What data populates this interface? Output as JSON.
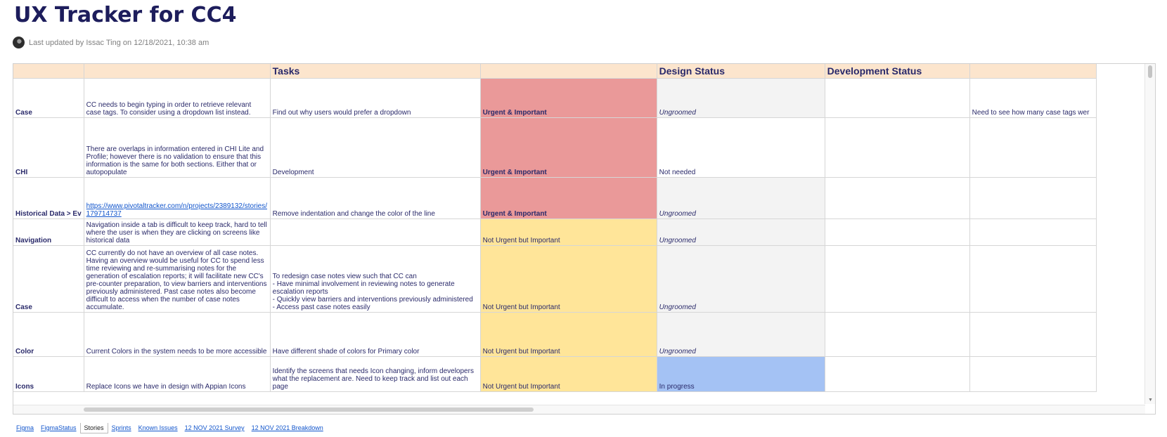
{
  "page": {
    "title": "UX Tracker for CC4",
    "last_updated": "Last updated by Issac Ting on 12/18/2021, 10:38 am"
  },
  "sheet": {
    "headers": [
      "",
      "",
      "Tasks",
      "",
      "Design Status",
      "Development Status",
      ""
    ],
    "rows": [
      {
        "category": "Case",
        "issue": "CC needs to begin typing in order to retrieve relevant case tags. To consider using a dropdown list instead.",
        "task": "Find out why users would prefer a dropdown",
        "priority": "Urgent & Important",
        "design_status": "Ungroomed",
        "dev_status": "",
        "notes": "Need to see how many case tags wer"
      },
      {
        "category": "CHI",
        "issue": "There are overlaps in information entered in CHI Lite and Profile; however there is no validation to ensure that this information is the same for both sections. Either that or autopopulate",
        "task": "Development",
        "priority": "Urgent & Important",
        "design_status": "Not needed",
        "dev_status": "",
        "notes": ""
      },
      {
        "category": "Historical Data > Ev",
        "issue": "https://www.pivotaltracker.com/n/projects/2389132/stories/179714737",
        "task": "Remove indentation and change the color of the line",
        "priority": "Urgent & Important",
        "design_status": "Ungroomed",
        "dev_status": "",
        "notes": ""
      },
      {
        "category": "Navigation",
        "issue": "Navigation inside a tab is difficult to keep track, hard to tell where the user is when they are clicking on screens like historical data",
        "task": "",
        "priority": "Not Urgent but Important",
        "design_status": "Ungroomed",
        "dev_status": "",
        "notes": ""
      },
      {
        "category": "Case",
        "issue": "CC currently do not have an overview of all case notes. Having an overview would be useful for CC to spend less time reviewing and re-summarising notes for the generation of escalation reports; it will facilitate new CC's pre-counter preparation, to view barriers and interventions previously administered. Past case notes also become difficult to access when the number of case notes accumulate.",
        "task": "To redesign case notes view such that CC can\n- Have minimal involvement in reviewing notes to generate escalation reports\n- Quickly view barriers and interventions previously administered\n- Access past case notes easily",
        "priority": "Not Urgent but Important",
        "design_status": "Ungroomed",
        "dev_status": "",
        "notes": ""
      },
      {
        "category": "Color",
        "issue": "Current Colors in the system needs to be more accessible",
        "task": "Have different shade of colors for Primary color",
        "priority": "Not Urgent but Important",
        "design_status": "Ungroomed",
        "dev_status": "",
        "notes": ""
      },
      {
        "category": "Icons",
        "issue": "Replace Icons we have in design with Appian Icons",
        "task": "Identify the screens that needs Icon changing, inform developers what the replacement are. Need to keep track and list out each page",
        "priority": "Not Urgent but Important",
        "design_status": "In progress",
        "dev_status": "",
        "notes": ""
      }
    ]
  },
  "tabs": [
    "Figma",
    "FigmaStatus",
    "Stories",
    "Sprints",
    "Known Issues",
    "12 NOV 2021 Survey",
    "12 NOV 2021 Breakdown"
  ],
  "active_tab": "Stories",
  "colors": {
    "header_bg": "#fce5cd",
    "urgent_important": "#ea9999",
    "not_urgent_important": "#ffe599",
    "ungroomed_bg": "#f3f3f3",
    "in_progress": "#a4c2f4",
    "link": "#1155cc"
  }
}
